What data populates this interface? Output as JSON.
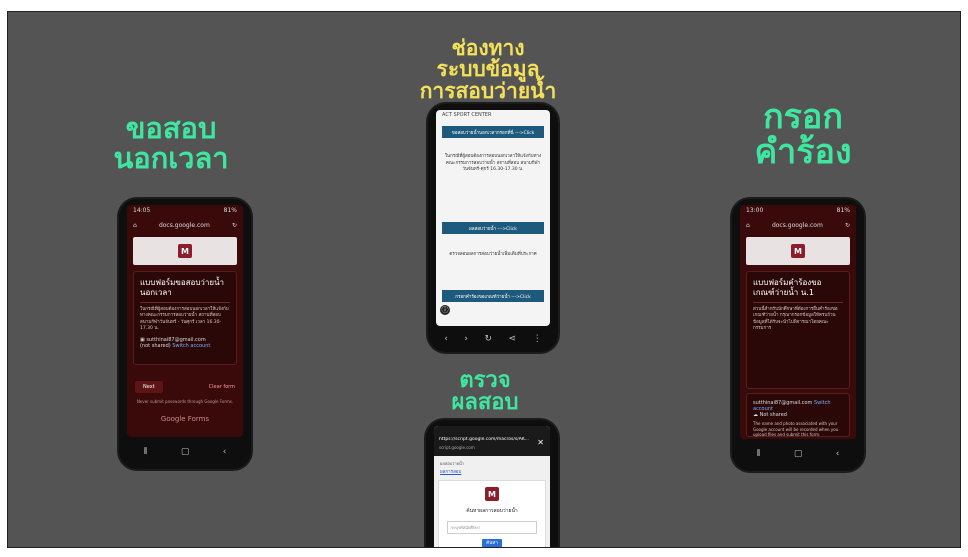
{
  "titles": {
    "left": [
      "ขอสอบ",
      "นอกเวลา"
    ],
    "center": [
      "ช่องทาง",
      "ระบบข้อมูล",
      "การสอบว่ายน้ำ"
    ],
    "right": [
      "กรอก",
      "คำร้อง"
    ],
    "bottom": [
      "ตรวจ",
      "ผลสอบ"
    ]
  },
  "colors": {
    "background": "#545454",
    "green_title": "#3ee6a0",
    "yellow_title": "#f3e15a",
    "form_dark_red": "#3a0a0a",
    "site_blue": "#1e5a7e"
  },
  "phone_left": {
    "status_time": "14:05",
    "battery": "81%",
    "url": "docs.google.com",
    "form_title": "แบบฟอร์มขอสอบว่ายน้ำนอกเวลา",
    "description": "ในกรณีที่ผู้สอบต้องการสอบนอกเวลาให้แจ้งกับทางคณะกรรมการสอบว่ายน้ำ สถานที่สอบ สนามกีฬาวันจันทร์ - วันศุกร์ เวลา 16.30-17.30 น.",
    "account": "sutthinai87@gmail.com",
    "account_link": "Switch account",
    "not_shared": "(not shared)",
    "next_label": "Next",
    "clear_label": "Clear form",
    "footer_note": "Never submit passwords through Google Forms.",
    "google_forms": "Google Forms"
  },
  "phone_center": {
    "site_name": "ACT SPORT CENTER",
    "bar1": "ขอสอบว่ายน้ำนอกเวลากรอกที่นี่ --->Click",
    "text1": "ในกรณีที่ผู้สอบต้องการสอบนอกเวลาให้แจ้งกับทางคณะกรรมการสอบว่ายน้ำ สถานที่สอบ สนามกีฬา วันจันทร์-ศุกร์ 16.30-17.30 น.",
    "bar2": "ผลสอบว่ายน้ำ --->Click",
    "text2": "ตรวจสอบผลการสอบว่ายน้ำเพิ่มเติมที่ประกาศ",
    "bar3": "กรอกคำร้องขอเกณฑ์ว่ายน้ำ --->Click"
  },
  "phone_bottom": {
    "url_title": "https://script.google.com/macros/s/AK...",
    "url_sub": "script.google.com",
    "line1": "ผลสอบว่ายน้ำ",
    "link": "ผลการสอบ",
    "heading": "ค้นหาผลการสอบว่ายน้ำ",
    "placeholder": "ระบุรหัสนักศึกษา",
    "button": "ค้นหา"
  },
  "phone_right": {
    "status_time": "13:00",
    "battery": "81%",
    "url": "docs.google.com",
    "form_title": "แบบฟอร์มคำร้องขอเกณฑ์ว่ายน้ำ น.1",
    "description": "ส่วนนี้สำหรับนักศึกษาที่ต้องการยื่นคำร้องขอเกณฑ์ว่ายน้ำ กรุณากรอกข้อมูลให้ครบถ้วน ข้อมูลที่ได้รับจะนำไปพิจารณาโดยคณะกรรมการ",
    "account": "sutthinai87@gmail.com",
    "account_link": "Switch account",
    "not_shared": "Not shared",
    "privacy_note": "The name and photo associated with your Google account will be recorded when you upload files and submit this form."
  }
}
